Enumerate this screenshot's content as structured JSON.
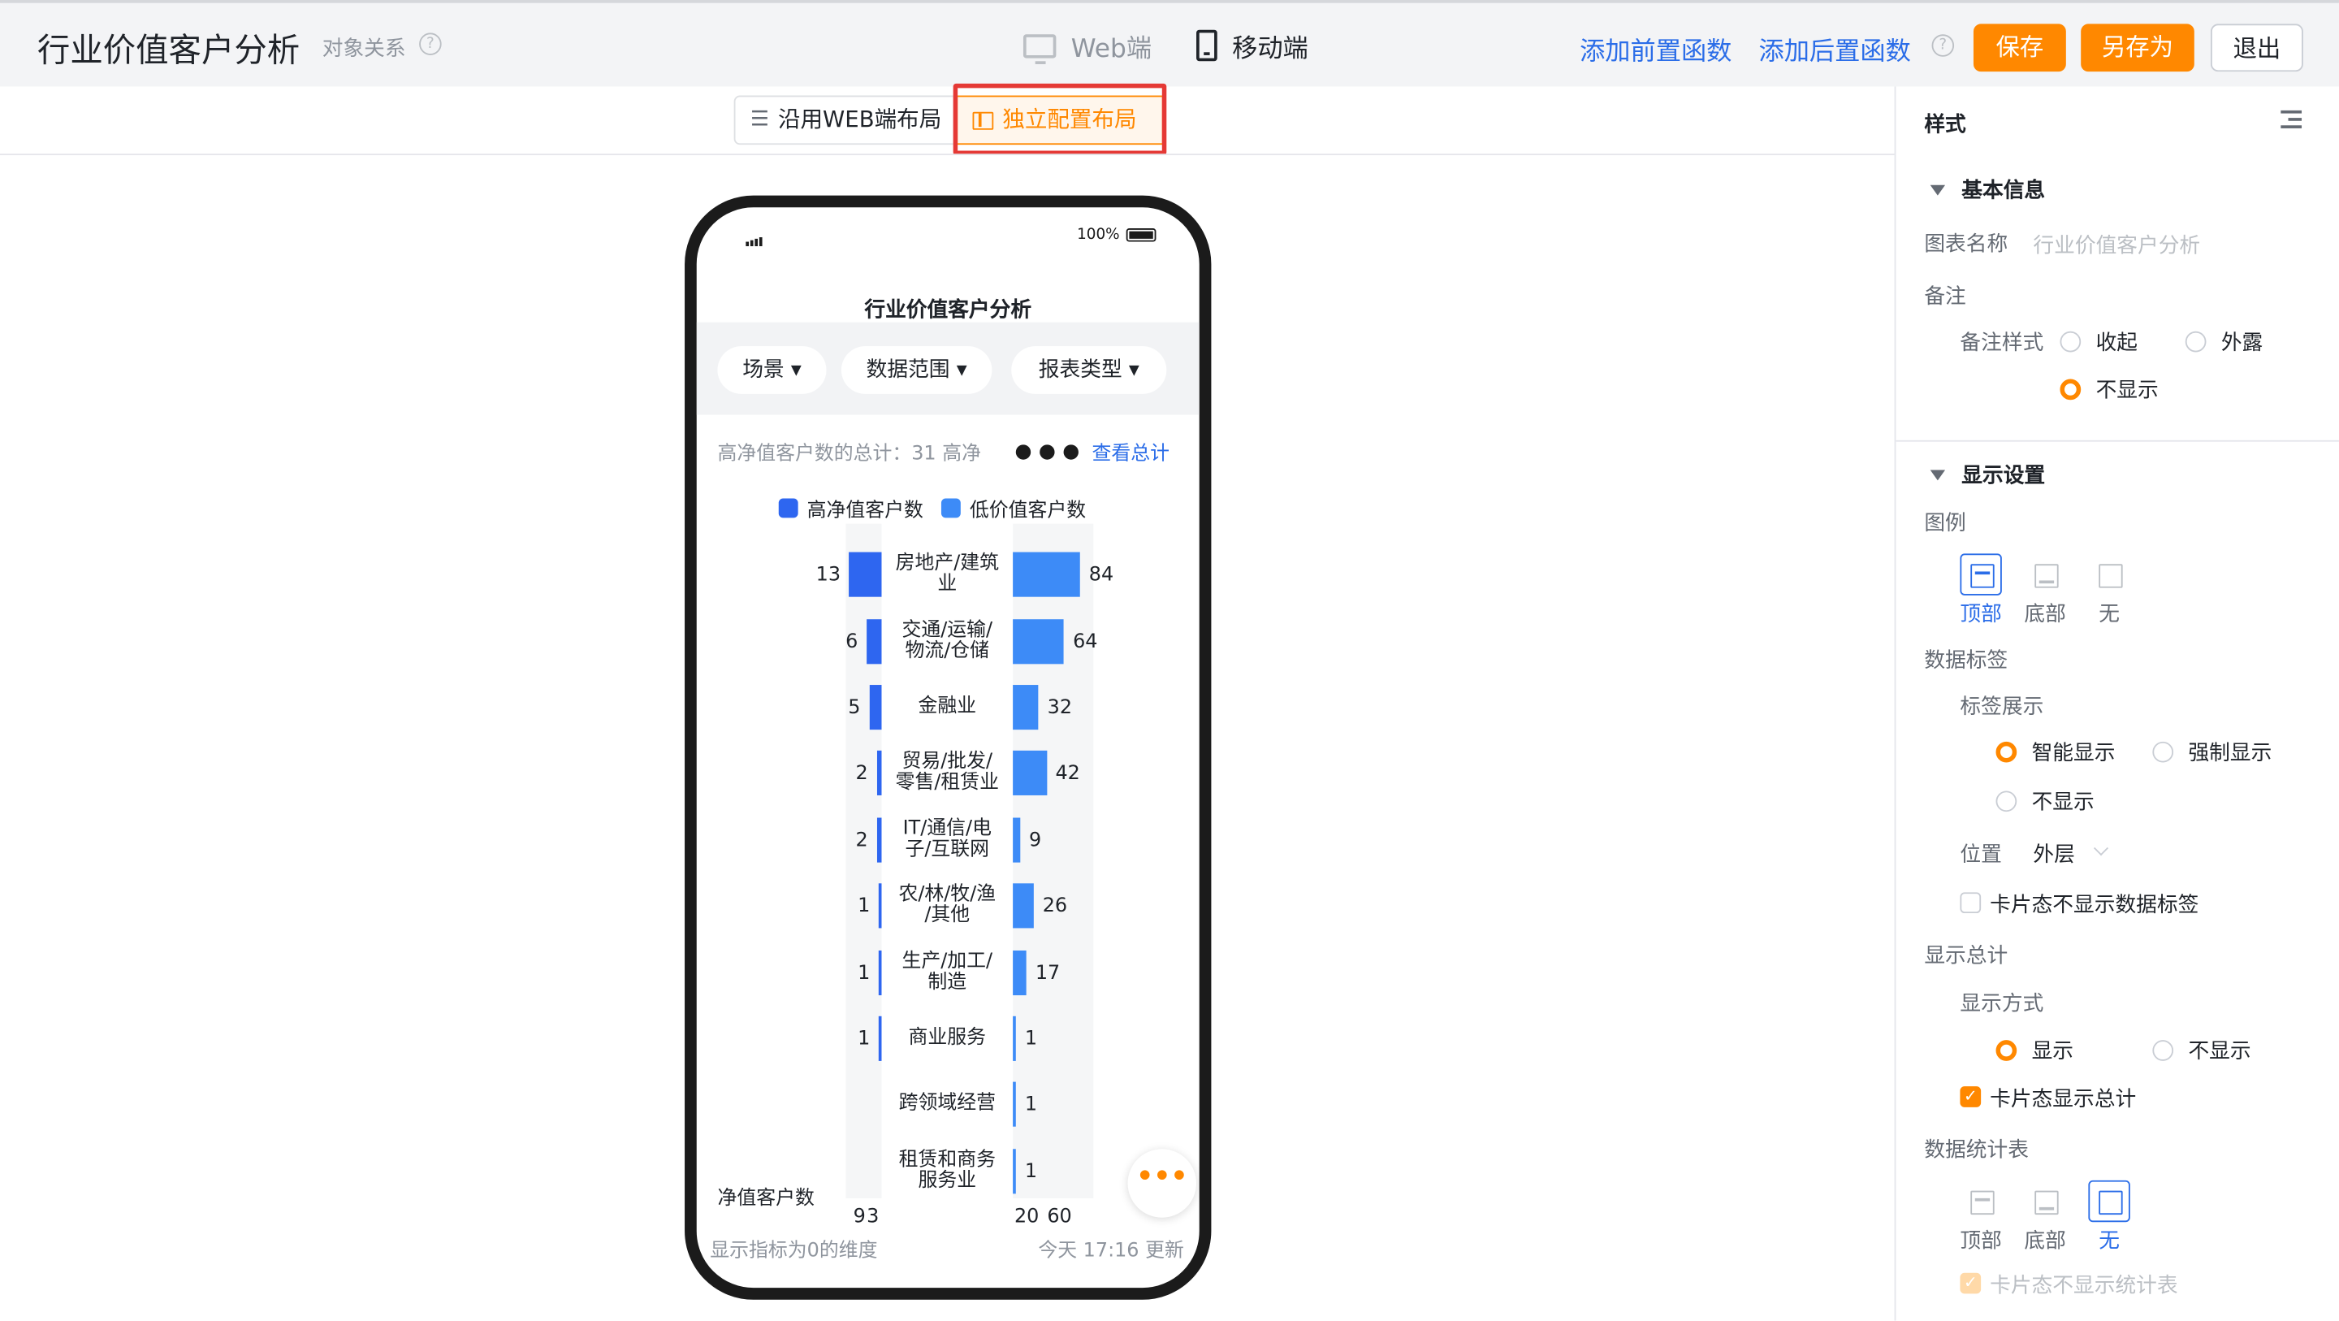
{
  "header": {
    "title": "行业价值客户分析",
    "subtitle": "对象关系",
    "mode_web": "Web端",
    "mode_mobile": "移动端",
    "add_pre_func": "添加前置函数",
    "add_post_func": "添加后置函数",
    "save": "保存",
    "save_as": "另存为",
    "exit": "退出",
    "help_glyph": "?"
  },
  "layout_switch": {
    "use_web": "沿用WEB端布局",
    "independent": "独立配置布局"
  },
  "phone": {
    "battery": "100%",
    "title": "行业价值客户分析",
    "filters": [
      "场景 ▾",
      "数据范围 ▾",
      "报表类型 ▾"
    ],
    "summary_text": "高净值客户数的总计：31  高净",
    "view_all": "查看总计",
    "legend": [
      {
        "name": "高净值客户数",
        "color": "#2e66f0"
      },
      {
        "name": "低价值客户数",
        "color": "#3d8bf7"
      }
    ],
    "axis_name": "净值客户数",
    "left_ticks": [
      "9",
      "3"
    ],
    "right_ticks": [
      "20",
      "60"
    ],
    "footer_left": "显示指标为0的维度",
    "footer_right": "今天 17:16 更新",
    "fab": "•••"
  },
  "chart_data": {
    "type": "bar",
    "orientation": "horizontal-butterfly",
    "categories": [
      [
        "房地产/建筑",
        "业"
      ],
      [
        "交通/运输/",
        "物流/仓储"
      ],
      [
        "金融业"
      ],
      [
        "贸易/批发/",
        "零售/租赁业"
      ],
      [
        "IT/通信/电",
        "子/互联网"
      ],
      [
        "农/林/牧/渔",
        "/其他"
      ],
      [
        "生产/加工/",
        "制造"
      ],
      [
        "商业服务"
      ],
      [
        "跨领域经营"
      ],
      [
        "租赁和商务",
        "服务业"
      ]
    ],
    "series": [
      {
        "name": "高净值客户数",
        "values": [
          13,
          6,
          5,
          2,
          2,
          1,
          1,
          1,
          null,
          null
        ],
        "labels": [
          "13",
          "6",
          "5",
          "2",
          "2",
          "1",
          "1",
          "1",
          "",
          ""
        ]
      },
      {
        "name": "低价值客户数",
        "values": [
          84,
          64,
          32,
          42,
          9,
          26,
          17,
          1,
          1,
          1
        ],
        "labels": [
          "84",
          "64",
          "32",
          "42",
          "9",
          "26",
          "17",
          "1",
          "1",
          "1"
        ]
      }
    ]
  },
  "panel": {
    "title": "样式",
    "basic_info": "基本信息",
    "chart_name_label": "图表名称",
    "chart_name_value": "行业价值客户分析",
    "note_label": "备注",
    "note_style_label": "备注样式",
    "note_opts": [
      "收起",
      "外露",
      "不显示"
    ],
    "display_settings": "显示设置",
    "legend_label": "图例",
    "legend_opts": [
      "顶部",
      "底部",
      "无"
    ],
    "data_label": "数据标签",
    "label_show": "标签展示",
    "label_opts": [
      "智能显示",
      "强制显示",
      "不显示"
    ],
    "position_label": "位置",
    "position_value": "外层",
    "card_no_label": "卡片态不显示数据标签",
    "show_total": "显示总计",
    "show_mode": "显示方式",
    "show_opts": [
      "显示",
      "不显示"
    ],
    "card_show_total": "卡片态显示总计",
    "data_table": "数据统计表",
    "table_opts": [
      "顶部",
      "底部",
      "无"
    ],
    "card_no_table": "卡片态不显示统计表",
    "check_glyph": "✓"
  },
  "colors": {
    "accent": "#ff8800",
    "link": "#2b6de8",
    "bar_dark": "#2e66f0",
    "bar_light": "#3d8bf7",
    "highlight": "#e53935"
  }
}
